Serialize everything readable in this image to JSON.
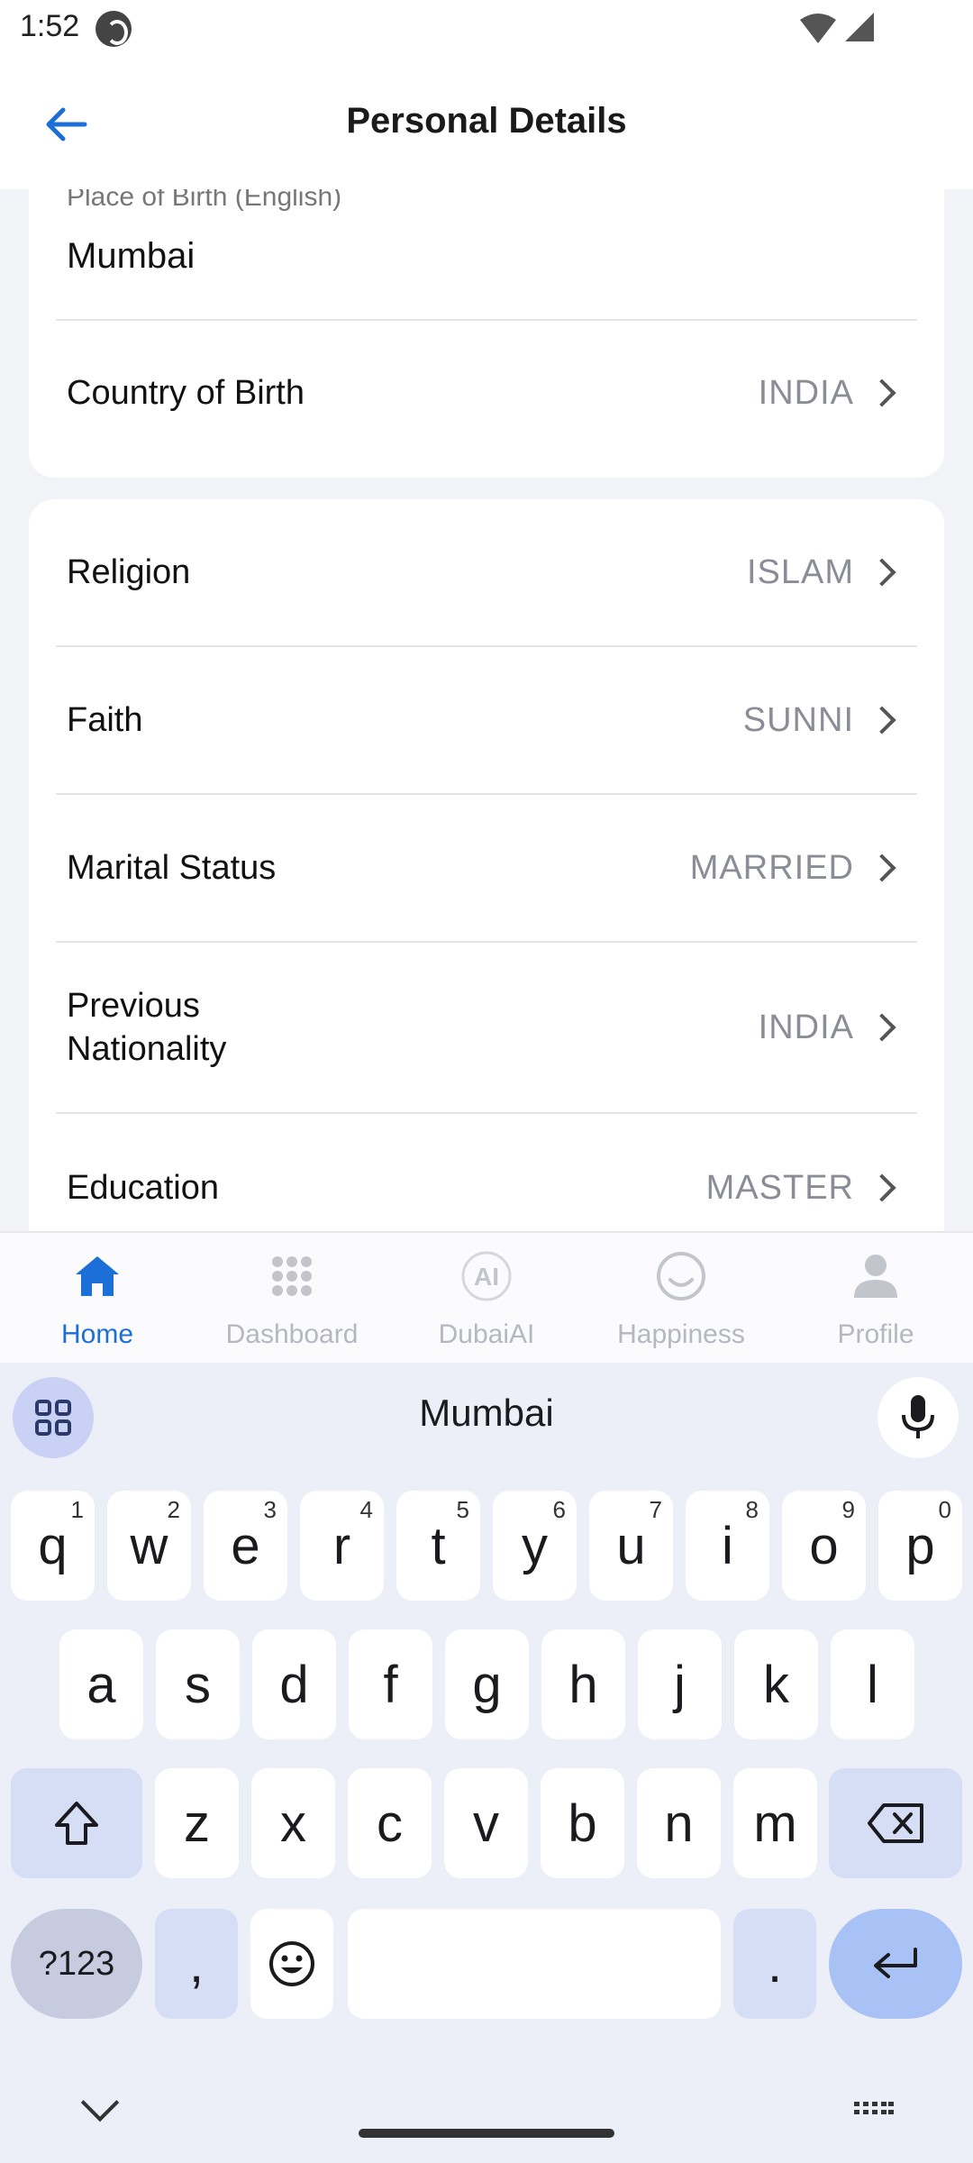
{
  "status_bar": {
    "time": "1:52"
  },
  "header": {
    "title": "Personal Details"
  },
  "form": {
    "place_of_birth": {
      "label": "Place of Birth (English)",
      "value": "Mumbai"
    },
    "country_of_birth": {
      "label": "Country of Birth",
      "value": "INDIA"
    },
    "religion": {
      "label": "Religion",
      "value": "ISLAM"
    },
    "faith": {
      "label": "Faith",
      "value": "SUNNI"
    },
    "marital_status": {
      "label": "Marital Status",
      "value": "MARRIED"
    },
    "previous_nationality": {
      "label": "Previous Nationality",
      "value": "INDIA"
    },
    "education": {
      "label": "Education",
      "value": "MASTER"
    }
  },
  "bottom_nav": {
    "items": [
      {
        "label": "Home",
        "icon": "home-icon",
        "active": true
      },
      {
        "label": "Dashboard",
        "icon": "dashboard-grid-icon",
        "active": false
      },
      {
        "label": "DubaiAI",
        "icon": "dubai-ai-icon",
        "active": false
      },
      {
        "label": "Happiness",
        "icon": "smiley-icon",
        "active": false
      },
      {
        "label": "Profile",
        "icon": "person-icon",
        "active": false
      }
    ]
  },
  "keyboard": {
    "suggestion": "Mumbai",
    "row1": [
      {
        "key": "q",
        "hint": "1"
      },
      {
        "key": "w",
        "hint": "2"
      },
      {
        "key": "e",
        "hint": "3"
      },
      {
        "key": "r",
        "hint": "4"
      },
      {
        "key": "t",
        "hint": "5"
      },
      {
        "key": "y",
        "hint": "6"
      },
      {
        "key": "u",
        "hint": "7"
      },
      {
        "key": "i",
        "hint": "8"
      },
      {
        "key": "o",
        "hint": "9"
      },
      {
        "key": "p",
        "hint": "0"
      }
    ],
    "row2": [
      "a",
      "s",
      "d",
      "f",
      "g",
      "h",
      "j",
      "k",
      "l"
    ],
    "row3": [
      "z",
      "x",
      "c",
      "v",
      "b",
      "n",
      "m"
    ],
    "symbols_label": "?123",
    "comma": ",",
    "period": "."
  },
  "colors": {
    "accent": "#1c6fd6",
    "muted_value": "#8a8d96",
    "inactive_nav": "#b5b8c0"
  }
}
